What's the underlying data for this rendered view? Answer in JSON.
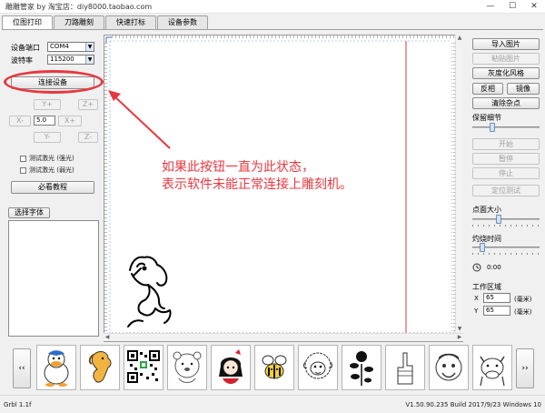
{
  "window": {
    "title": "雕雕管家 by 淘宝店：diy8000.taobao.com",
    "controls": {
      "minimize": "—",
      "maximize": "☐",
      "close": "✕"
    }
  },
  "tabs": [
    {
      "label": "位图打印",
      "active": true
    },
    {
      "label": "刀路雕刻",
      "active": false
    },
    {
      "label": "快速打标",
      "active": false
    },
    {
      "label": "设备参数",
      "active": false
    }
  ],
  "left_panel": {
    "port_label": "设备端口",
    "port_value": "COM4",
    "baud_label": "波特率",
    "baud_value": "115200",
    "connect_button": "连接设备",
    "jog": {
      "y_plus": "Y+",
      "z_plus": "Z+",
      "x_minus": "X-",
      "step": "5.0",
      "x_plus": "X+",
      "y_minus": "Y-",
      "z_minus": "Z-"
    },
    "test_laser_strong": "测试激光 (强光)",
    "test_laser_weak": "测试激光 (弱光)",
    "tutorial_button": "必看教程",
    "font_button": "选择字体"
  },
  "annotation": {
    "line1": "如果此按钮一直为此状态，",
    "line2": "表示软件未能正常连接上雕刻机。",
    "color": "#e8373f"
  },
  "right_panel": {
    "import_image": "导入图片",
    "paste_image": "粘贴图片",
    "grayscale": "灰度化风格",
    "invert": "反相",
    "mirror": "镜像",
    "clear_noise": "清除杂点",
    "keep_detail_label": "保留细节",
    "start": "开始",
    "pause": "暂停",
    "stop": "停止",
    "locate_test": "定位测试",
    "dot_size_label": "点面大小",
    "burn_time_label": "灼烧时间",
    "time_value": "0:00",
    "work_area_label": "工作区域",
    "x_label": "X",
    "x_value": "65",
    "x_unit": "(毫米)",
    "y_label": "Y",
    "y_value": "65",
    "y_unit": "(毫米)",
    "keep_detail_level": 0.28,
    "dot_size_level": 0.38,
    "burn_time_level": 0.12
  },
  "gallery": {
    "prev": "‹‹",
    "next": "››",
    "items": [
      "duck",
      "horse",
      "qr-code",
      "bear",
      "anime-girl",
      "bee",
      "sheep",
      "flower",
      "hand",
      "face",
      "cow"
    ]
  },
  "status": {
    "left": "Grbl 1.1f",
    "right": "V1.50.90.235 Build 2017/9/23 Windows 10"
  }
}
